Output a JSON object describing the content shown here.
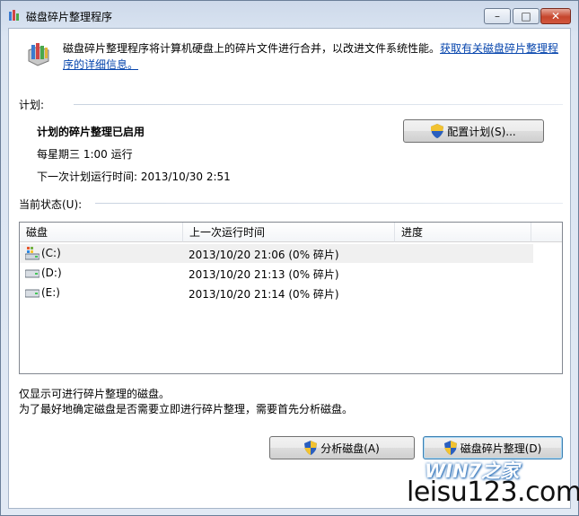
{
  "window": {
    "title": "磁盘碎片整理程序",
    "controls": {
      "minimize": "–",
      "maximize": "□",
      "close": "✕"
    }
  },
  "intro": {
    "text": "磁盘碎片整理程序将计算机硬盘上的碎片文件进行合并，以改进文件系统性能。",
    "link": "获取有关磁盘碎片整理程序的详细信息。"
  },
  "schedule": {
    "section_label": "计划:",
    "status": "计划的碎片整理已启用",
    "frequency": "每星期三  1:00 运行",
    "next_run": "下一次计划运行时间: 2013/10/30 2:51",
    "configure_button": "配置计划(S)..."
  },
  "current_status": {
    "section_label": "当前状态(U):",
    "columns": [
      "磁盘",
      "上一次运行时间",
      "进度"
    ],
    "rows": [
      {
        "disk": "(C:)",
        "last_run": "2013/10/20 21:06 (0% 碎片)",
        "progress": "",
        "icon": "system-drive-icon"
      },
      {
        "disk": "(D:)",
        "last_run": "2013/10/20 21:13 (0% 碎片)",
        "progress": "",
        "icon": "drive-icon"
      },
      {
        "disk": "(E:)",
        "last_run": "2013/10/20 21:14 (0% 碎片)",
        "progress": "",
        "icon": "drive-icon"
      }
    ]
  },
  "notes": {
    "line1": "仅显示可进行碎片整理的磁盘。",
    "line2": "为了最好地确定磁盘是否需要立即进行碎片整理，需要首先分析磁盘。"
  },
  "buttons": {
    "analyze": "分析磁盘(A)",
    "defragment": "磁盘碎片整理(D)"
  },
  "watermark": {
    "logo": "WIN7之家",
    "site": "leisu123.com"
  },
  "colors": {
    "link": "#0645ad",
    "accent": "#3c7fb1"
  }
}
